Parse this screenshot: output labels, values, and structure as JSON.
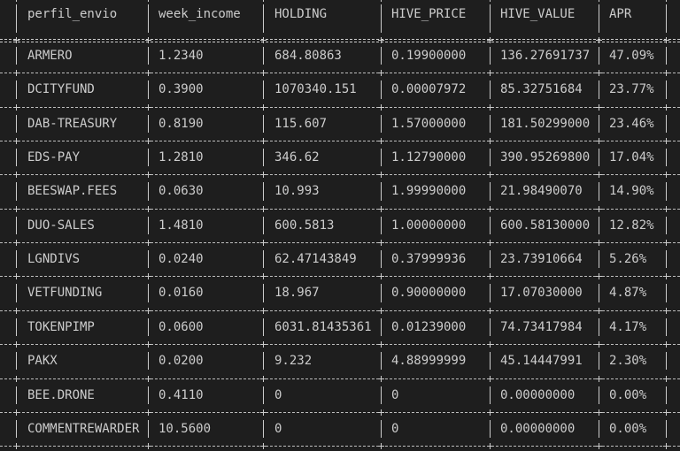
{
  "table": {
    "headers": [
      "perfil_envio",
      "week_income",
      "HOLDING",
      "HIVE_PRICE",
      "HIVE_VALUE",
      "APR"
    ],
    "rows": [
      [
        "ARMERO",
        "1.2340",
        "684.80863",
        "0.19900000",
        "136.27691737",
        "47.09%"
      ],
      [
        "DCITYFUND",
        "0.3900",
        "1070340.151",
        "0.00007972",
        "85.32751684",
        "23.77%"
      ],
      [
        "DAB-TREASURY",
        "0.8190",
        "115.607",
        "1.57000000",
        "181.50299000",
        "23.46%"
      ],
      [
        "EDS-PAY",
        "1.2810",
        "346.62",
        "1.12790000",
        "390.95269800",
        "17.04%"
      ],
      [
        "BEESWAP.FEES",
        "0.0630",
        "10.993",
        "1.99990000",
        "21.98490070",
        "14.90%"
      ],
      [
        "DUO-SALES",
        "1.4810",
        "600.5813",
        "1.00000000",
        "600.58130000",
        "12.82%"
      ],
      [
        "LGNDIVS",
        "0.0240",
        "62.47143849",
        "0.37999936",
        "23.73910664",
        "5.26%"
      ],
      [
        "VETFUNDING",
        "0.0160",
        "18.967",
        "0.90000000",
        "17.07030000",
        "4.87%"
      ],
      [
        "TOKENPIMP",
        "0.0600",
        "6031.81435361",
        "0.01239000",
        "74.73417984",
        "4.17%"
      ],
      [
        "PAKX",
        "0.0200",
        "9.232",
        "4.88999999",
        "45.14447991",
        "2.30%"
      ],
      [
        "BEE.DRONE",
        "0.4110",
        "0",
        "0",
        "0.00000000",
        "0.00%"
      ],
      [
        "COMMENTREWARDER",
        "10.5600",
        "0",
        "0",
        "0.00000000",
        "0.00%"
      ]
    ]
  }
}
